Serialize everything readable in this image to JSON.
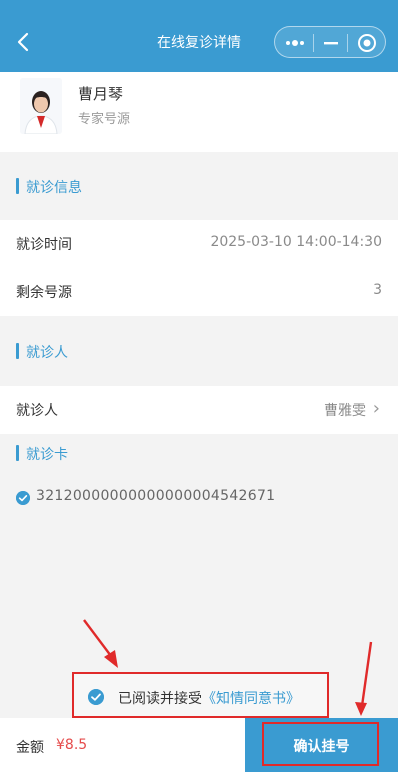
{
  "colors": {
    "primary": "#3a9bd1",
    "highlight": "#e02a2a",
    "price": "#e54b4b"
  },
  "navbar": {
    "title": "在线复诊详情",
    "icons": [
      "back-icon",
      "more-icon",
      "minimize-icon",
      "close-target-icon"
    ]
  },
  "doctor": {
    "name": "曹月琴",
    "type": "专家号源"
  },
  "visit_info": {
    "section_title": "就诊信息",
    "time_label": "就诊时间",
    "time_value": "2025-03-10 14:00-14:30",
    "remaining_label": "剩余号源",
    "remaining_value": "3"
  },
  "patient": {
    "section_title": "就诊人",
    "label": "就诊人",
    "value": "曹雅雯",
    "arrow": "›"
  },
  "card": {
    "section_title": "就诊卡",
    "number": "32120000000000000004542671",
    "icon": "check-circle-icon"
  },
  "consent": {
    "text": "已阅读并接受",
    "link": "《知情同意书》",
    "icon": "check-circle-icon"
  },
  "footer": {
    "amount_label": "金额",
    "amount_value": "¥8.5",
    "confirm_label": "确认挂号"
  }
}
